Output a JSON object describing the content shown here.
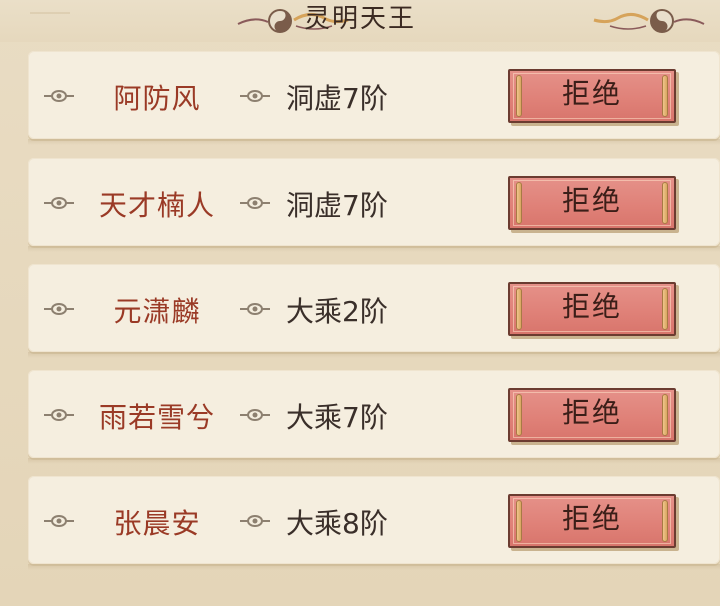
{
  "header": {
    "title": "灵明天王"
  },
  "rows": [
    {
      "name": "阿防风",
      "realm": "洞虚7阶",
      "button": "拒绝"
    },
    {
      "name": "天才楠人",
      "realm": "洞虚7阶",
      "button": "拒绝"
    },
    {
      "name": "元潇麟",
      "realm": "大乘2阶",
      "button": "拒绝"
    },
    {
      "name": "雨若雪兮",
      "realm": "大乘7阶",
      "button": "拒绝"
    },
    {
      "name": "张晨安",
      "realm": "大乘8阶",
      "button": "拒绝"
    }
  ],
  "colors": {
    "name_text": "#9a3a26",
    "realm_text": "#3a2f2a",
    "button_fill": "#df8077",
    "row_bg": "#f5eedf"
  },
  "icons": {
    "bullet": "eye-bullet-icon",
    "title_ornament": "yin-yang-cloud-ornament-icon"
  }
}
